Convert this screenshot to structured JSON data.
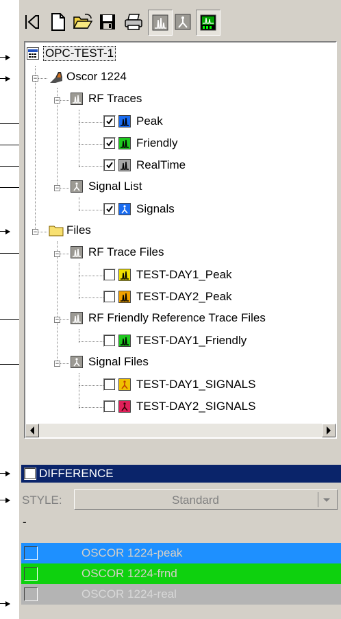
{
  "toolbar": {
    "buttons": [
      {
        "name": "collapse-panel-icon"
      },
      {
        "name": "new-file-icon"
      },
      {
        "name": "open-folder-icon"
      },
      {
        "name": "save-icon"
      },
      {
        "name": "print-icon"
      },
      {
        "name": "rf-traces-view-icon",
        "pressed": true
      },
      {
        "name": "signal-view-icon"
      },
      {
        "name": "spectrum-display-icon"
      }
    ]
  },
  "tree": {
    "root": "OPC-TEST-1",
    "device": "Oscor 1224",
    "rf_traces": {
      "label": "RF Traces",
      "items": [
        {
          "label": "Peak",
          "checked": true,
          "color": "#1a6cf0"
        },
        {
          "label": "Friendly",
          "checked": true,
          "color": "#1ec81e"
        },
        {
          "label": "RealTime",
          "checked": true,
          "color": "#a8a8a8"
        }
      ]
    },
    "signal_list": {
      "label": "Signal List",
      "items": [
        {
          "label": "Signals",
          "checked": true,
          "color": "#1a6cf0"
        }
      ]
    },
    "files": {
      "label": "Files",
      "rf_trace_files": {
        "label": "RF Trace Files",
        "items": [
          {
            "label": "TEST-DAY1_Peak",
            "checked": false,
            "color": "#f0e000"
          },
          {
            "label": "TEST-DAY2_Peak",
            "checked": false,
            "color": "#f0a000"
          }
        ]
      },
      "rf_friendly_files": {
        "label": "RF Friendly Reference Trace Files",
        "items": [
          {
            "label": "TEST-DAY1_Friendly",
            "checked": false,
            "color": "#1ec81e"
          }
        ]
      },
      "signal_files": {
        "label": "Signal Files",
        "items": [
          {
            "label": "TEST-DAY1_SIGNALS",
            "checked": false,
            "color": "#f0c000"
          },
          {
            "label": "TEST-DAY2_SIGNALS",
            "checked": false,
            "color": "#e0205a"
          }
        ]
      }
    }
  },
  "difference": {
    "label": "DIFFERENCE",
    "checked": false
  },
  "style": {
    "label": "STYLE:",
    "value": "Standard"
  },
  "separator": "-",
  "sources": [
    {
      "label": "OSCOR 1224-peak",
      "color": "#1e90ff"
    },
    {
      "label": "OSCOR 1224-frnd",
      "color": "#0ed10e"
    },
    {
      "label": "OSCOR 1224-real",
      "color": "#b4b4b4"
    }
  ]
}
